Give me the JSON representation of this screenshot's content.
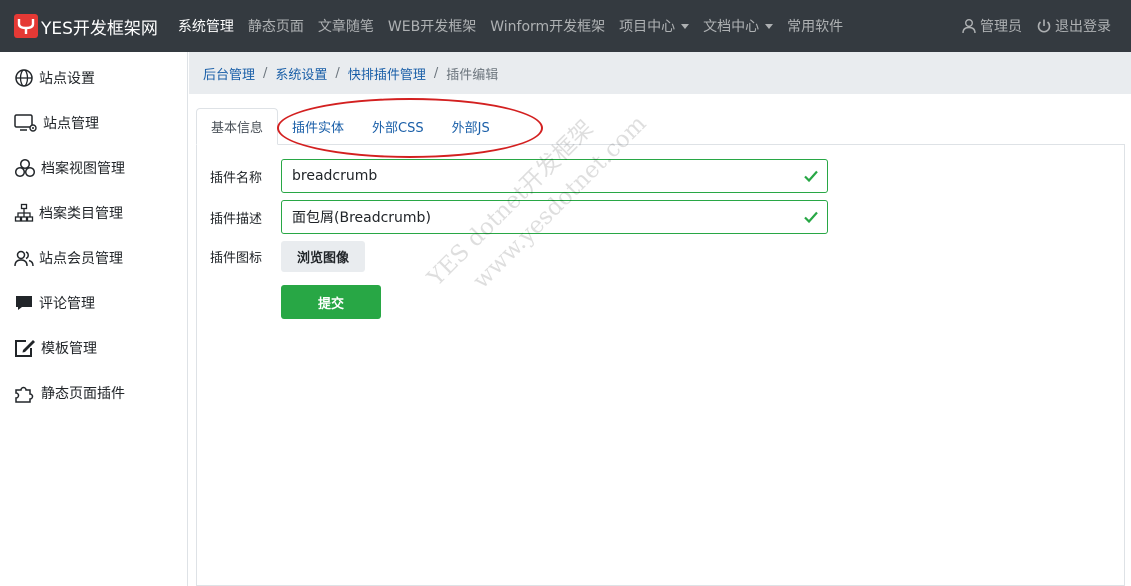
{
  "brand": {
    "name": "YES开发框架网",
    "logo_icon": "yes-logo-icon"
  },
  "nav": {
    "items": [
      {
        "label": "系统管理",
        "active": true
      },
      {
        "label": "静态页面"
      },
      {
        "label": "文章随笔"
      },
      {
        "label": "WEB开发框架"
      },
      {
        "label": "Winform开发框架"
      },
      {
        "label": "项目中心",
        "dropdown": true
      },
      {
        "label": "文档中心",
        "dropdown": true
      },
      {
        "label": "常用软件"
      }
    ],
    "user": {
      "label": "管理员",
      "icon": "user-icon"
    },
    "logout": {
      "label": "退出登录",
      "icon": "power-icon"
    }
  },
  "sidebar": {
    "items": [
      {
        "label": "站点设置",
        "icon": "globe-icon"
      },
      {
        "label": "站点管理",
        "icon": "monitor-gear-icon"
      },
      {
        "label": "档案视图管理",
        "icon": "circles-icon"
      },
      {
        "label": "档案类目管理",
        "icon": "hierarchy-icon"
      },
      {
        "label": "站点会员管理",
        "icon": "users-icon"
      },
      {
        "label": "评论管理",
        "icon": "comment-icon"
      },
      {
        "label": "模板管理",
        "icon": "edit-frame-icon"
      },
      {
        "label": "静态页面插件",
        "icon": "puzzle-icon"
      }
    ]
  },
  "breadcrumb": {
    "items": [
      "后台管理",
      "系统设置",
      "快排插件管理"
    ],
    "current": "插件编辑"
  },
  "tabs": [
    {
      "label": "基本信息",
      "active": true
    },
    {
      "label": "插件实体"
    },
    {
      "label": "外部CSS"
    },
    {
      "label": "外部JS"
    }
  ],
  "form": {
    "name_label": "插件名称",
    "name_value": "breadcrumb",
    "desc_label": "插件描述",
    "desc_value": "面包屑(Breadcrumb)",
    "icon_label": "插件图标",
    "browse_label": "浏览图像",
    "submit_label": "提交"
  },
  "watermark": {
    "line1": "YES dotnet开发框架",
    "line2": "www.yesdotnet.com"
  },
  "colors": {
    "navbar": "#343a40",
    "success": "#28a745",
    "link": "#1a5fa8",
    "highlight_ellipse": "#d32020",
    "logo": "#e53935"
  }
}
